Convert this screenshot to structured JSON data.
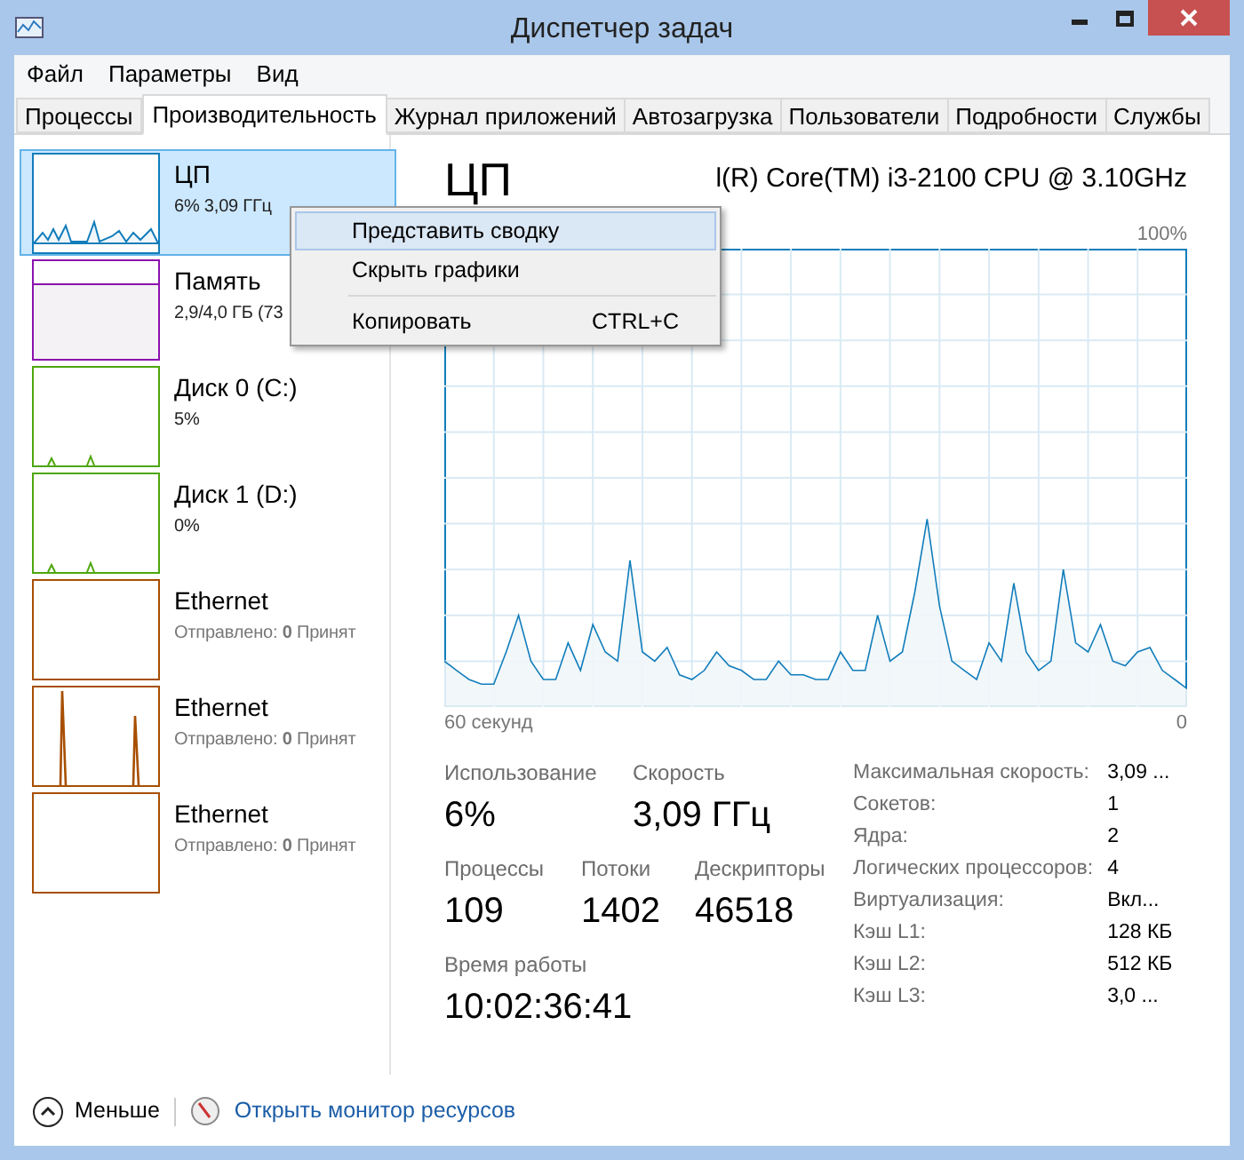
{
  "window": {
    "title": "Диспетчер задач"
  },
  "menu_bar": [
    "Файл",
    "Параметры",
    "Вид"
  ],
  "tabs": [
    {
      "label": "Процессы",
      "selected": false
    },
    {
      "label": "Производительность",
      "selected": true
    },
    {
      "label": "Журнал приложений",
      "selected": false
    },
    {
      "label": "Автозагрузка",
      "selected": false
    },
    {
      "label": "Пользователи",
      "selected": false
    },
    {
      "label": "Подробности",
      "selected": false
    },
    {
      "label": "Службы",
      "selected": false
    }
  ],
  "sidebar": {
    "items": [
      {
        "kind": "cpu",
        "title": "ЦП",
        "subtitle": "6%  3,09 ГГц",
        "color": "#117dbb",
        "selected": true
      },
      {
        "kind": "memory",
        "title": "Память",
        "subtitle": "2,9/4,0 ГБ (73",
        "color": "#8b12ae",
        "selected": false
      },
      {
        "kind": "disk",
        "title": "Диск 0 (C:)",
        "subtitle": "5%",
        "color": "#4da60c",
        "selected": false
      },
      {
        "kind": "disk",
        "title": "Диск 1 (D:)",
        "subtitle": "0%",
        "color": "#4da60c",
        "selected": false
      },
      {
        "kind": "ethernet",
        "title": "Ethernet",
        "subtitle": "Отправлено: **0** Принят",
        "color": "#a74f01",
        "selected": false
      },
      {
        "kind": "ethernet-spikes",
        "title": "Ethernet",
        "subtitle": "Отправлено: **0** Принят",
        "color": "#a74f01",
        "selected": false
      },
      {
        "kind": "ethernet",
        "title": "Ethernet",
        "subtitle": "Отправлено: **0** Принят",
        "color": "#a74f01",
        "selected": false
      }
    ]
  },
  "detail": {
    "title": "ЦП",
    "processor": "l(R) Core(TM) i3-2100 CPU @ 3.10GHz",
    "top_label": "100%",
    "left_label": "60 секунд",
    "right_label": "0",
    "stats": [
      {
        "label": "Использование",
        "value": "6%"
      },
      {
        "label": "Скорость",
        "value": "3,09 ГГц"
      }
    ],
    "counts": [
      {
        "label": "Процессы",
        "value": "109"
      },
      {
        "label": "Потоки",
        "value": "1402"
      },
      {
        "label": "Дескрипторы",
        "value": "46518"
      }
    ],
    "uptime": {
      "label": "Время работы",
      "value": "10:02:36:41"
    },
    "properties": [
      {
        "key": "Максимальная скорость:",
        "value": "3,09 ..."
      },
      {
        "key": "Сокетов:",
        "value": "1"
      },
      {
        "key": "Ядра:",
        "value": "2"
      },
      {
        "key": "Логических процессоров:",
        "value": "4"
      },
      {
        "key": "Виртуализация:",
        "value": "Вкл..."
      },
      {
        "key": "Кэш L1:",
        "value": "128 КБ"
      },
      {
        "key": "Кэш L2:",
        "value": "512 КБ"
      },
      {
        "key": "Кэш L3:",
        "value": "3,0 ..."
      }
    ]
  },
  "context_menu": {
    "items": [
      {
        "label": "Представить сводку",
        "selected": true
      },
      {
        "label": "Скрыть графики",
        "selected": false
      },
      {
        "label": "Копировать",
        "shortcut": "CTRL+C",
        "separator_before": true,
        "selected": false
      }
    ]
  },
  "footer": {
    "less": "Меньше",
    "link": "Открыть монитор ресурсов"
  }
}
